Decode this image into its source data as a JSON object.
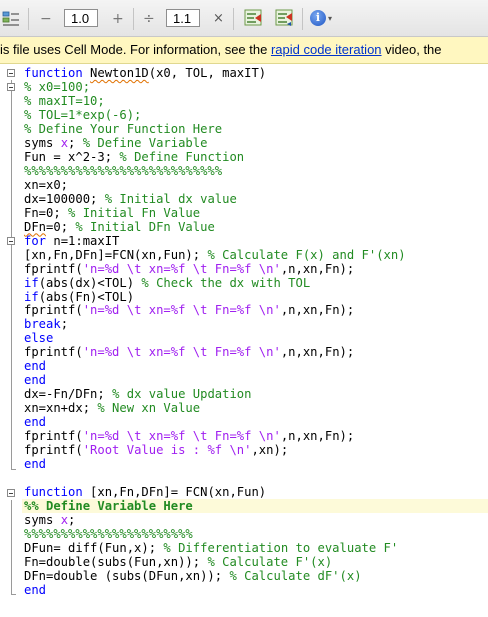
{
  "toolbar": {
    "minus": "−",
    "step_value": "1.0",
    "plus": "+",
    "divide": "÷",
    "scale_value": "1.1",
    "times": "×",
    "dropdown": "▾"
  },
  "info": {
    "text_before": "is file uses Cell Mode. For information, see the ",
    "link": "rapid code iteration",
    "text_after": " video, the"
  },
  "colors": {
    "keyword": "#0000ff",
    "comment": "#228b22",
    "string": "#a020f0",
    "cell_background": "#fdfad9",
    "info_bar": "#fff7c0"
  },
  "code": [
    [
      [
        "kw",
        "function "
      ],
      [
        "sq",
        "Newton1D"
      ],
      [
        "",
        "(x0, TOL, maxIT)"
      ]
    ],
    [
      [
        "cm",
        "% x0=100;"
      ]
    ],
    [
      [
        "cm",
        "% maxIT=10;"
      ]
    ],
    [
      [
        "cm",
        "% TOL=1*exp(-6);"
      ]
    ],
    [
      [
        "cm",
        "% Define Your Function Here"
      ]
    ],
    [
      [
        "",
        "syms "
      ],
      [
        "st",
        "x"
      ],
      [
        "",
        ";"
      ],
      [
        "cm",
        " % Define Variable"
      ]
    ],
    [
      [
        "",
        "Fun = x^2-3; "
      ],
      [
        "cm",
        "% Define Function"
      ]
    ],
    [
      [
        "cm",
        "%%%%%%%%%%%%%%%%%%%%%%%%%%%"
      ]
    ],
    [
      [
        "",
        "xn=x0;"
      ]
    ],
    [
      [
        "",
        "dx=100000; "
      ],
      [
        "cm",
        "% Initial dx value"
      ]
    ],
    [
      [
        "",
        "Fn=0; "
      ],
      [
        "cm",
        "% Initial Fn Value"
      ]
    ],
    [
      [
        "sq",
        "DFn"
      ],
      [
        "",
        "=0; "
      ],
      [
        "cm",
        "% Initial DFn Value"
      ]
    ],
    [
      [
        "kw",
        "for "
      ],
      [
        "",
        "n=1:maxIT"
      ]
    ],
    [
      [
        "",
        "[xn,Fn,DFn]=FCN(xn,Fun); "
      ],
      [
        "cm",
        "% Calculate F(x) and F'(xn)"
      ]
    ],
    [
      [
        "",
        "fprintf("
      ],
      [
        "st",
        "'n=%d \\t xn=%f \\t Fn=%f \\n'"
      ],
      [
        "",
        ",n,xn,Fn);"
      ]
    ],
    [
      [
        "kw",
        "if"
      ],
      [
        "",
        "(abs(dx)<TOL) "
      ],
      [
        "cm",
        "% Check the dx with TOL"
      ]
    ],
    [
      [
        "kw",
        "if"
      ],
      [
        "",
        "(abs(Fn)<TOL)"
      ]
    ],
    [
      [
        "",
        "fprintf("
      ],
      [
        "st",
        "'n=%d \\t xn=%f \\t Fn=%f \\n'"
      ],
      [
        "",
        ",n,xn,Fn);"
      ]
    ],
    [
      [
        "kw",
        "break"
      ],
      [
        "",
        ";"
      ]
    ],
    [
      [
        "kw",
        "else"
      ]
    ],
    [
      [
        "",
        "fprintf("
      ],
      [
        "st",
        "'n=%d \\t xn=%f \\t Fn=%f \\n'"
      ],
      [
        "",
        ",n,xn,Fn);"
      ]
    ],
    [
      [
        "kw",
        "end"
      ]
    ],
    [
      [
        "kw",
        "end"
      ]
    ],
    [
      [
        "",
        "dx=-Fn/DFn; "
      ],
      [
        "cm",
        "% dx value Updation"
      ]
    ],
    [
      [
        "",
        "xn=xn+dx; "
      ],
      [
        "cm",
        "% New xn Value"
      ]
    ],
    [
      [
        "kw",
        "end"
      ]
    ],
    [
      [
        "",
        "fprintf("
      ],
      [
        "st",
        "'n=%d \\t xn=%f \\t Fn=%f \\n'"
      ],
      [
        "",
        ",n,xn,Fn);"
      ]
    ],
    [
      [
        "",
        "fprintf("
      ],
      [
        "st",
        "'Root Value is : %f \\n'"
      ],
      [
        "",
        ",xn);"
      ]
    ],
    [
      [
        "kw",
        "end"
      ]
    ],
    [],
    [
      [
        "kw",
        "function "
      ],
      [
        "",
        "[xn,Fn,DFn]= FCN(xn,Fun)"
      ]
    ],
    [
      [
        "cmb",
        "%% Define Variable Here"
      ]
    ],
    [
      [
        "",
        "syms "
      ],
      [
        "st",
        "x"
      ],
      [
        "",
        ";"
      ]
    ],
    [
      [
        "cm",
        "%%%%%%%%%%%%%%%%%%%%%%%"
      ]
    ],
    [
      [
        "",
        "DFun= diff(Fun,x); "
      ],
      [
        "cm",
        "% Differentiation to evaluate F'"
      ]
    ],
    [
      [
        "",
        "Fn=double(subs(Fun,xn)); "
      ],
      [
        "cm",
        "% Calculate F'(x)"
      ]
    ],
    [
      [
        "",
        "DFn=double (subs(DFun,xn)); "
      ],
      [
        "cm",
        "% Calculate dF'(x)"
      ]
    ],
    [
      [
        "kw",
        "end"
      ]
    ]
  ]
}
